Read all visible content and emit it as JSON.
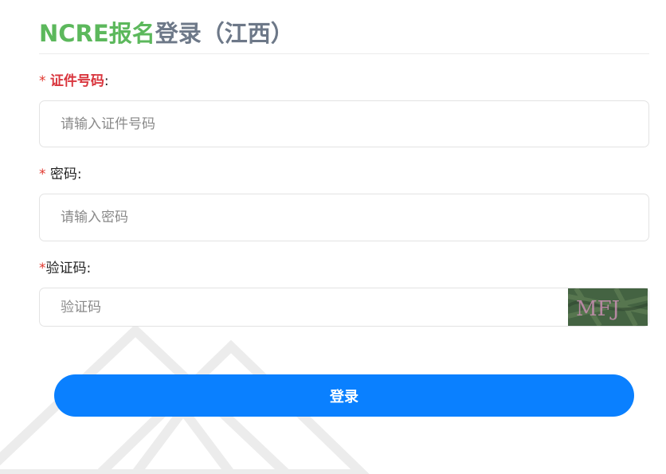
{
  "title": {
    "brand": "NCRE",
    "highlight": "报名",
    "rest": "登录（江西）"
  },
  "form": {
    "id_number": {
      "required_mark": "*",
      "label": "证件号码",
      "colon": ":",
      "placeholder": "请输入证件号码",
      "value": ""
    },
    "password": {
      "required_mark": "*",
      "label": "密码",
      "colon": ":",
      "placeholder": "请输入密码",
      "value": ""
    },
    "captcha": {
      "required_mark": "*",
      "label": "验证码",
      "colon": ":",
      "placeholder": "验证码",
      "value": "",
      "image_text": "MFJ"
    }
  },
  "login_button": {
    "label": "登录"
  },
  "colors": {
    "brand_green": "#5cb85c",
    "title_gray": "#6d7888",
    "required_red": "#e0362d",
    "label_red": "#d9363e",
    "primary_blue": "#0a80ff"
  },
  "icons": {
    "captcha": "captcha-image",
    "background": "triangle-pattern"
  }
}
